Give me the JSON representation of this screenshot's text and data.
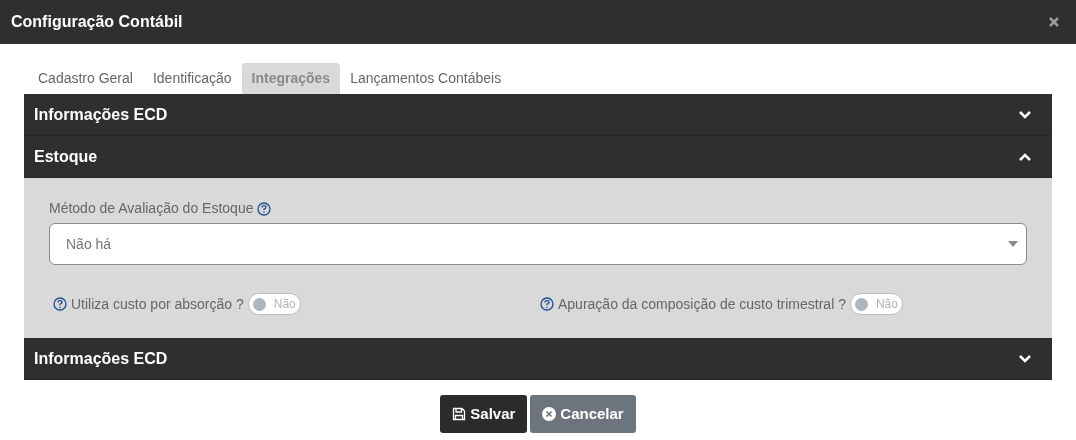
{
  "dialog": {
    "title": "Configuração Contábil"
  },
  "tabs": [
    {
      "label": "Cadastro Geral",
      "selected": false
    },
    {
      "label": "Identificação",
      "selected": false
    },
    {
      "label": "Integrações",
      "selected": true
    },
    {
      "label": "Lançamentos Contábeis",
      "selected": false
    }
  ],
  "sections": [
    {
      "title": "Informações ECD",
      "expanded": false
    },
    {
      "title": "Estoque",
      "expanded": true,
      "select": {
        "label": "Método de Avaliação do Estoque",
        "value": "Não há"
      },
      "toggles": [
        {
          "label": "Utiliza custo por absorção ?",
          "checked": false,
          "state_text": "Não"
        },
        {
          "label": "Apuração da composição de custo trimestral ?",
          "checked": false,
          "state_text": "Não"
        }
      ]
    },
    {
      "title": "Informações ECD",
      "expanded": false
    }
  ],
  "buttons": [
    {
      "label": "Salvar",
      "kind": "primary"
    },
    {
      "label": "Cancelar",
      "kind": "secondary"
    }
  ]
}
